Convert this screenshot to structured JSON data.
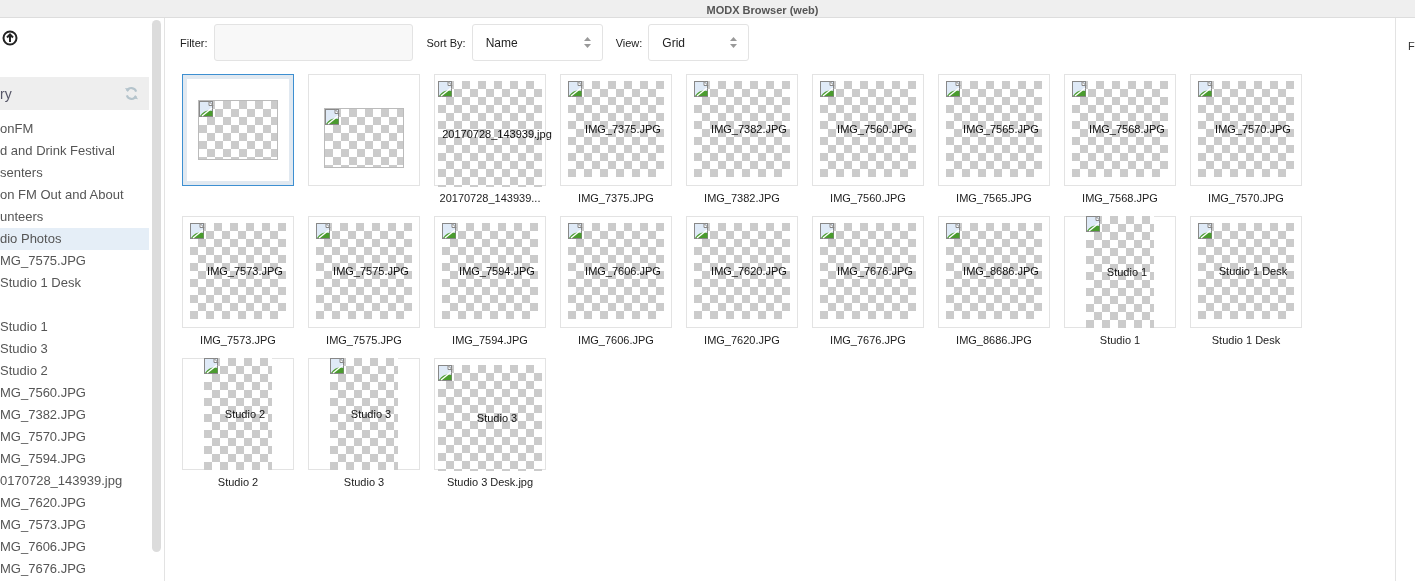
{
  "window": {
    "title": "MODX Browser (web)"
  },
  "sidebar": {
    "header": "ry",
    "groups": [
      [
        {
          "label": "onFM",
          "selected": false
        },
        {
          "label": "d and Drink Festival",
          "selected": false
        },
        {
          "label": "senters",
          "selected": false
        },
        {
          "label": "on FM Out and About",
          "selected": false
        },
        {
          "label": "unteers",
          "selected": false
        },
        {
          "label": "dio Photos",
          "selected": true
        },
        {
          "label": "MG_7575.JPG",
          "selected": false
        },
        {
          "label": "Studio 1 Desk",
          "selected": false
        }
      ],
      [
        {
          "label": "Studio 1",
          "selected": false
        },
        {
          "label": "Studio 3",
          "selected": false
        },
        {
          "label": "Studio 2",
          "selected": false
        },
        {
          "label": "MG_7560.JPG",
          "selected": false
        },
        {
          "label": "MG_7382.JPG",
          "selected": false
        },
        {
          "label": "MG_7570.JPG",
          "selected": false
        },
        {
          "label": "MG_7594.JPG",
          "selected": false
        },
        {
          "label": "0170728_143939.jpg",
          "selected": false
        },
        {
          "label": "MG_7620.JPG",
          "selected": false
        },
        {
          "label": "MG_7573.JPG",
          "selected": false
        },
        {
          "label": "MG_7606.JPG",
          "selected": false
        },
        {
          "label": "MG_7676.JPG",
          "selected": false
        }
      ]
    ]
  },
  "toolbar": {
    "filter_label": "Filter:",
    "sort_label": "Sort By:",
    "sort_value": "Name",
    "view_label": "View:",
    "view_value": "Grid"
  },
  "right_panel": {
    "label": "F"
  },
  "thumbnails": [
    {
      "kind": "wide",
      "selected": true
    },
    {
      "kind": "wide",
      "selected": false
    },
    {
      "kind": "overflow",
      "selected": false,
      "alt": "20170728_143939.jpg",
      "caption": "20170728_143939..."
    },
    {
      "kind": "square",
      "selected": false,
      "alt": "IMG_7375.JPG",
      "caption": "IMG_7375.JPG"
    },
    {
      "kind": "square",
      "selected": false,
      "alt": "IMG_7382.JPG",
      "caption": "IMG_7382.JPG"
    },
    {
      "kind": "square",
      "selected": false,
      "alt": "IMG_7560.JPG",
      "caption": "IMG_7560.JPG"
    },
    {
      "kind": "square",
      "selected": false,
      "alt": "IMG_7565.JPG",
      "caption": "IMG_7565.JPG"
    },
    {
      "kind": "square",
      "selected": false,
      "alt": "IMG_7568.JPG",
      "caption": "IMG_7568.JPG"
    },
    {
      "kind": "square",
      "selected": false,
      "alt": "IMG_7570.JPG",
      "caption": "IMG_7570.JPG"
    },
    {
      "kind": "square",
      "selected": false,
      "alt": "IMG_7573.JPG",
      "caption": "IMG_7573.JPG"
    },
    {
      "kind": "square",
      "selected": false,
      "alt": "IMG_7575.JPG",
      "caption": "IMG_7575.JPG"
    },
    {
      "kind": "square",
      "selected": false,
      "alt": "IMG_7594.JPG",
      "caption": "IMG_7594.JPG"
    },
    {
      "kind": "square",
      "selected": false,
      "alt": "IMG_7606.JPG",
      "caption": "IMG_7606.JPG"
    },
    {
      "kind": "square",
      "selected": false,
      "alt": "IMG_7620.JPG",
      "caption": "IMG_7620.JPG"
    },
    {
      "kind": "square",
      "selected": false,
      "alt": "IMG_7676.JPG",
      "caption": "IMG_7676.JPG"
    },
    {
      "kind": "square",
      "selected": false,
      "alt": "IMG_8686.JPG",
      "caption": "IMG_8686.JPG"
    },
    {
      "kind": "tall",
      "selected": false,
      "alt": "Studio 1",
      "caption": "Studio 1"
    },
    {
      "kind": "square",
      "selected": false,
      "alt": "Studio 1 Desk",
      "caption": "Studio 1 Desk"
    },
    {
      "kind": "tall",
      "selected": false,
      "alt": "Studio 2",
      "caption": "Studio 2"
    },
    {
      "kind": "tall",
      "selected": false,
      "alt": "Studio 3",
      "caption": "Studio 3"
    },
    {
      "kind": "overflow",
      "selected": false,
      "alt": "Studio 3",
      "caption": "Studio 3 Desk.jpg"
    }
  ]
}
